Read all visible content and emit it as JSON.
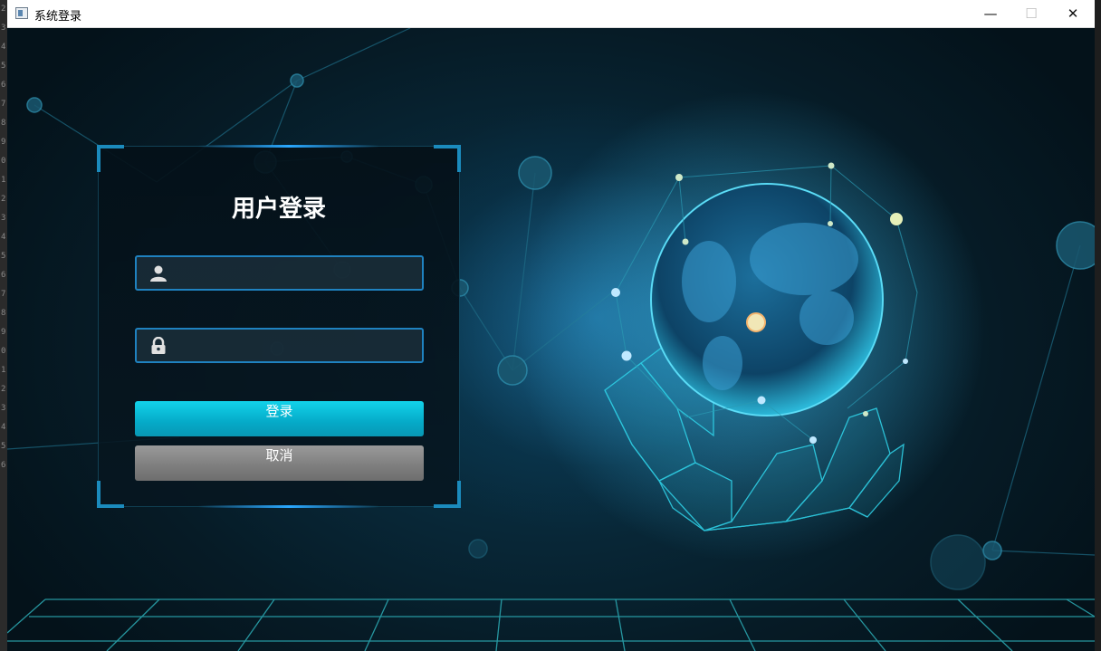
{
  "window": {
    "title": "系统登录",
    "controls": {
      "minimize": "—",
      "maximize": "☐",
      "close": "✕"
    }
  },
  "editor_gutter": [
    "2",
    "3",
    "4",
    "5",
    "6",
    "7",
    "8",
    "9",
    "0",
    "1",
    "2",
    "3",
    "4",
    "5",
    "6",
    "7",
    "8",
    "9",
    "0",
    "1",
    "2",
    "3",
    "4",
    "5",
    "6"
  ],
  "login": {
    "title": "用户登录",
    "username": {
      "value": "",
      "placeholder": "",
      "icon": "user-icon"
    },
    "password": {
      "value": "",
      "placeholder": "",
      "icon": "lock-icon"
    },
    "login_button": "登录",
    "cancel_button": "取消"
  },
  "colors": {
    "accent": "#1f82c0",
    "login_button": "#0ab8d6",
    "cancel_button": "#808080",
    "background": "#061b26"
  }
}
